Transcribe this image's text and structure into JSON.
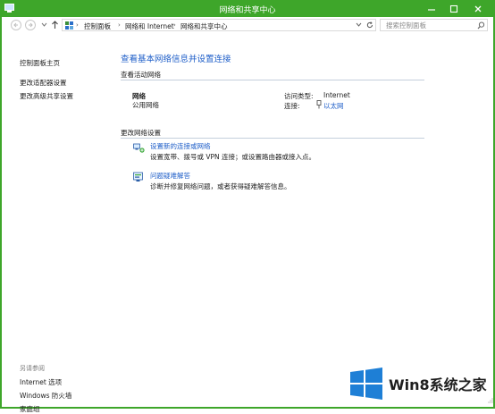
{
  "window": {
    "title": "网络和共享中心"
  },
  "address": {
    "crumbs": [
      "控制面板",
      "网络和 Internet",
      "网络和共享中心"
    ]
  },
  "search": {
    "placeholder": "搜索控制面板"
  },
  "sidebar": {
    "items": [
      {
        "label": "控制面板主页"
      },
      {
        "label": "更改适配器设置"
      },
      {
        "label": "更改高级共享设置"
      }
    ],
    "see_also": "另请参阅",
    "see_also_items": [
      {
        "label": "Internet 选项"
      },
      {
        "label": "Windows 防火墙"
      },
      {
        "label": "家庭组"
      }
    ]
  },
  "main": {
    "heading": "查看基本网络信息并设置连接",
    "active_section": "查看活动网络",
    "network_name": "网络",
    "network_type": "公用网络",
    "access_type_label": "访问类型:",
    "access_type_value": "Internet",
    "connections_label": "连接:",
    "connection_value": "以太网",
    "change_section": "更改网络设置",
    "tasks": [
      {
        "title": "设置新的连接或网络",
        "desc": "设置宽带、拨号或 VPN 连接；或设置路由器或接入点。"
      },
      {
        "title": "问题疑难解答",
        "desc": "诊断并修复网络问题，或者获得疑难解答信息。"
      }
    ]
  },
  "watermark": {
    "text": "Win8系统之家",
    "colors": [
      "#1e7fd6",
      "#ffffff"
    ]
  }
}
